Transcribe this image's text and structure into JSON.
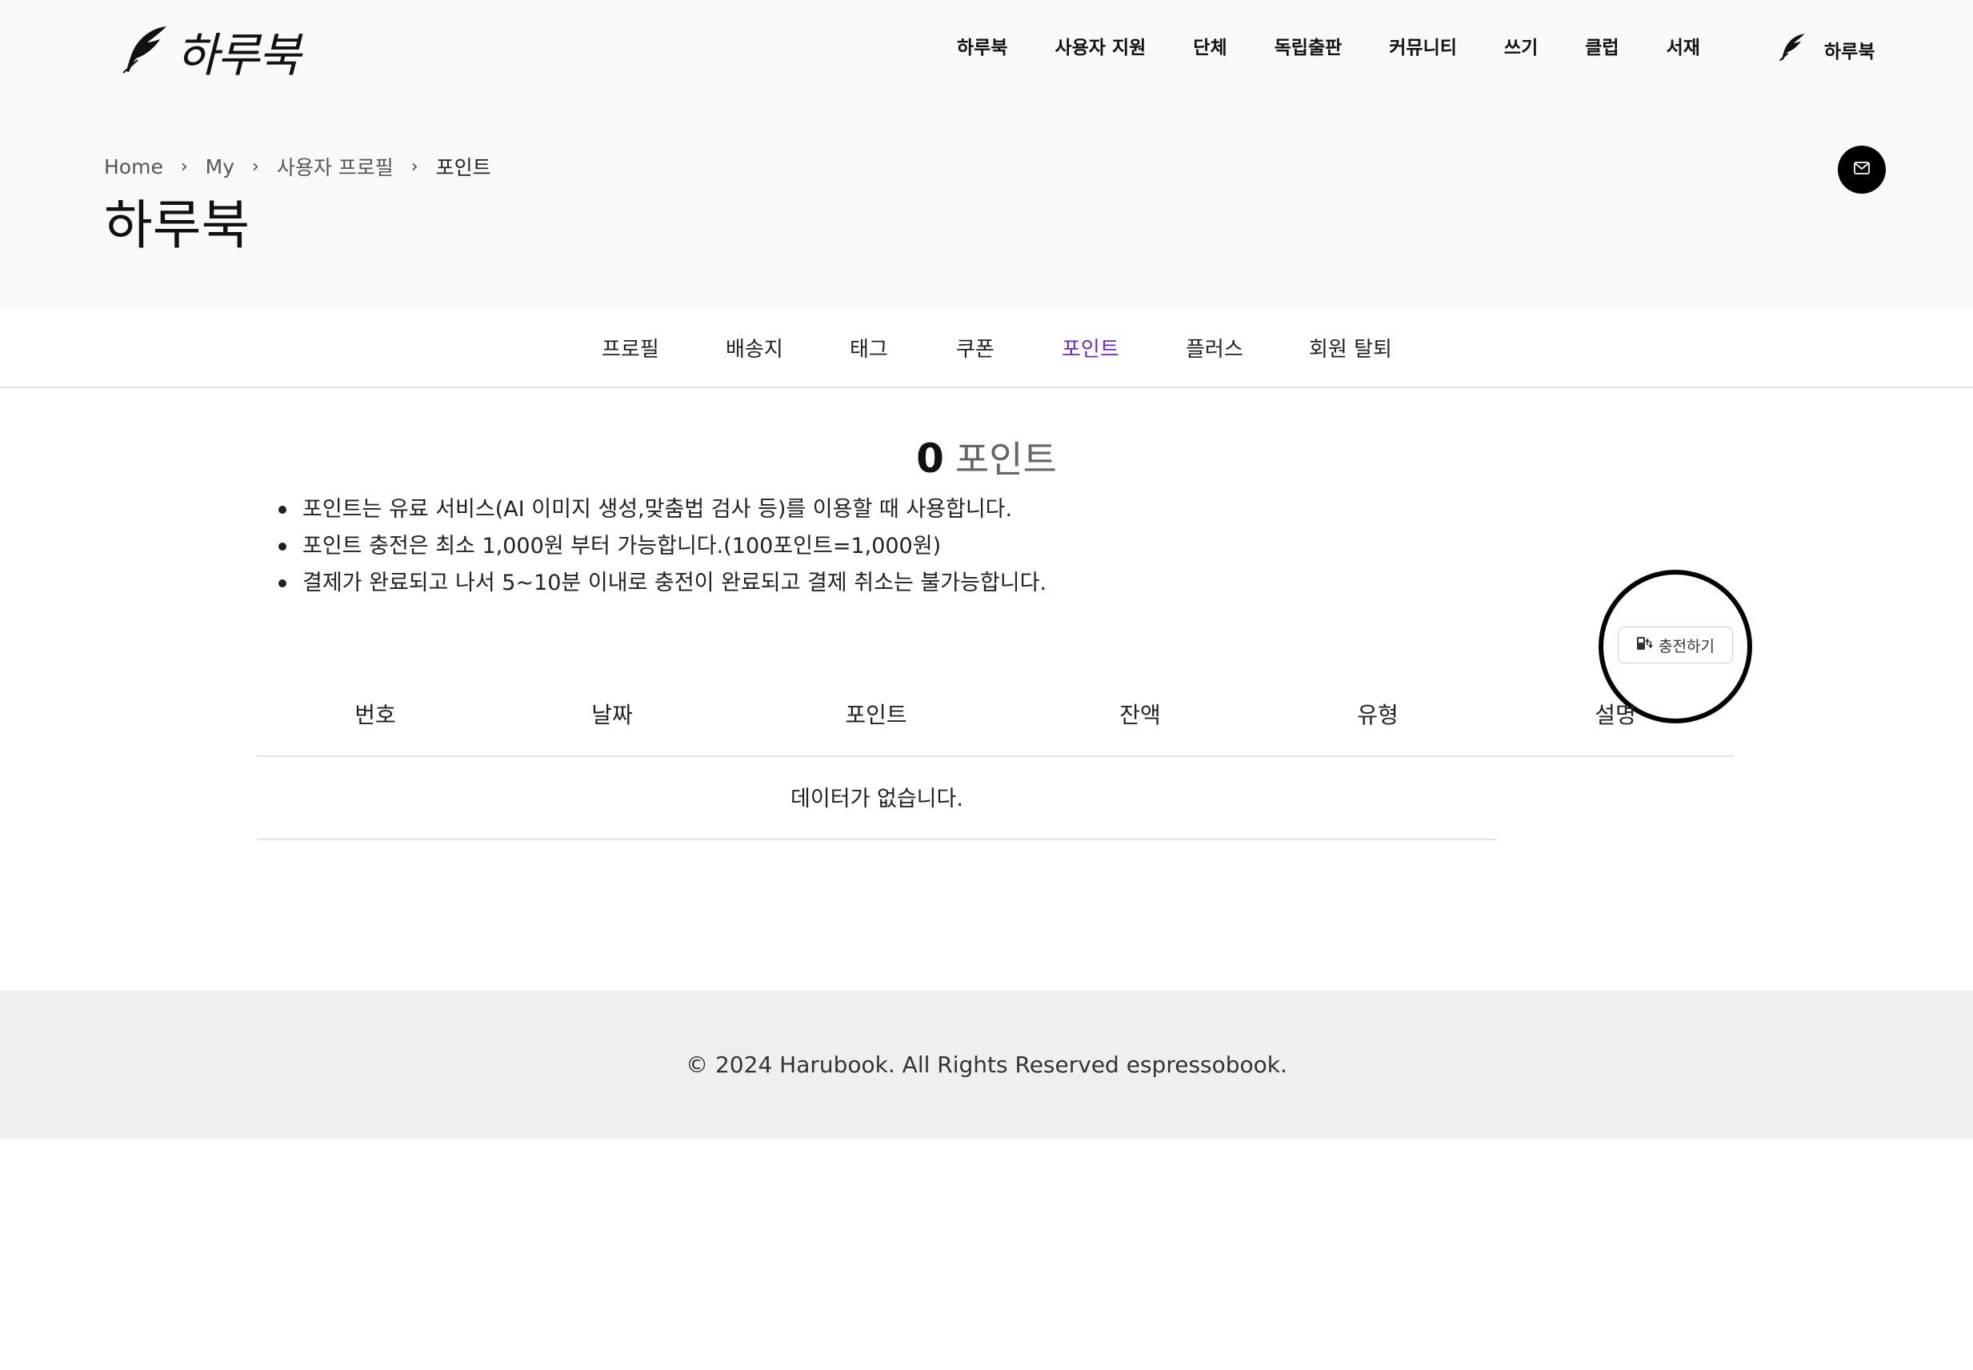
{
  "header": {
    "logo_text": "하루북",
    "nav": [
      "하루북",
      "사용자 지원",
      "단체",
      "독립출판",
      "커뮤니티",
      "쓰기",
      "클럽",
      "서재"
    ],
    "user_name": "하루북"
  },
  "breadcrumb": [
    "Home",
    "My",
    "사용자 프로필",
    "포인트"
  ],
  "page_title": "하루북",
  "tabs": [
    "프로필",
    "배송지",
    "태그",
    "쿠폰",
    "포인트",
    "플러스",
    "회원 탈퇴"
  ],
  "active_tab": "포인트",
  "points": {
    "value": "0",
    "unit": "포인트"
  },
  "info": [
    "포인트는 유료 서비스(AI 이미지 생성,맞춤법 검사 등)를 이용할 때 사용합니다.",
    "포인트 충전은 최소 1,000원 부터 가능합니다.(100포인트=1,000원)",
    "결제가 완료되고 나서 5~10분 이내로 충전이 완료되고 결제 취소는 불가능합니다."
  ],
  "charge_button_label": "충전하기",
  "table": {
    "columns": [
      "번호",
      "날짜",
      "포인트",
      "잔액",
      "유형",
      "설명"
    ],
    "empty_message": "데이터가 없습니다."
  },
  "footer": {
    "copyright": "© 2024 Harubook. All Rights Reserved espressobook."
  },
  "colors": {
    "accent": "#6b2bbd",
    "hero_bg": "#f9f9f9",
    "footer_bg": "#efeff1"
  }
}
